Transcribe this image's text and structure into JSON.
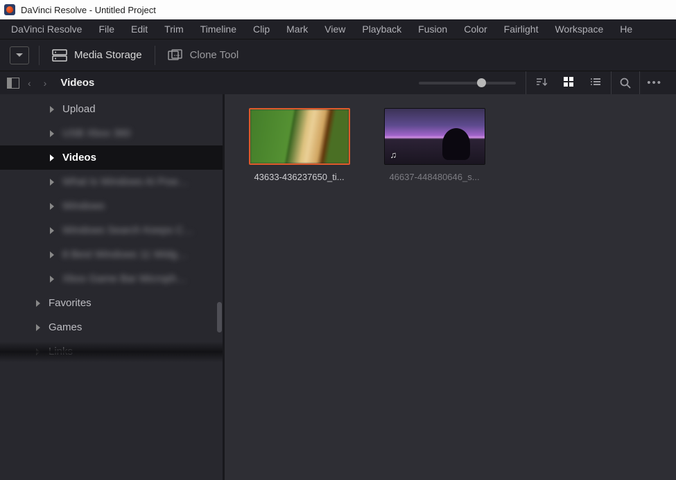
{
  "window": {
    "title": "DaVinci Resolve - Untitled Project"
  },
  "menu": {
    "items": [
      "DaVinci Resolve",
      "File",
      "Edit",
      "Trim",
      "Timeline",
      "Clip",
      "Mark",
      "View",
      "Playback",
      "Fusion",
      "Color",
      "Fairlight",
      "Workspace",
      "He"
    ]
  },
  "toolbar": {
    "media_storage": "Media Storage",
    "clone_tool": "Clone Tool"
  },
  "nav": {
    "path": "Videos"
  },
  "sidebar": {
    "items": [
      {
        "label": "Upload",
        "depth": 2,
        "blur": false,
        "active": false
      },
      {
        "label": "USB Xbox 360",
        "depth": 2,
        "blur": true,
        "active": false
      },
      {
        "label": "Videos",
        "depth": 2,
        "blur": false,
        "active": true
      },
      {
        "label": "What Is Windows AI Pow…",
        "depth": 2,
        "blur": true,
        "active": false
      },
      {
        "label": "Windows",
        "depth": 2,
        "blur": true,
        "active": false
      },
      {
        "label": "Windows Search Keeps C…",
        "depth": 2,
        "blur": true,
        "active": false
      },
      {
        "label": "8 Best Windows 11 Widg…",
        "depth": 2,
        "blur": true,
        "active": false
      },
      {
        "label": "Xbox Game Bar Microph…",
        "depth": 2,
        "blur": true,
        "active": false
      },
      {
        "label": "Favorites",
        "depth": 1,
        "blur": false,
        "active": false
      },
      {
        "label": "Games",
        "depth": 1,
        "blur": false,
        "active": false
      },
      {
        "label": "Links",
        "depth": 1,
        "blur": false,
        "active": false
      }
    ]
  },
  "clips": [
    {
      "label": "43633-436237650_ti...",
      "selected": true,
      "has_audio": false
    },
    {
      "label": "46637-448480646_s...",
      "selected": false,
      "has_audio": true
    }
  ]
}
